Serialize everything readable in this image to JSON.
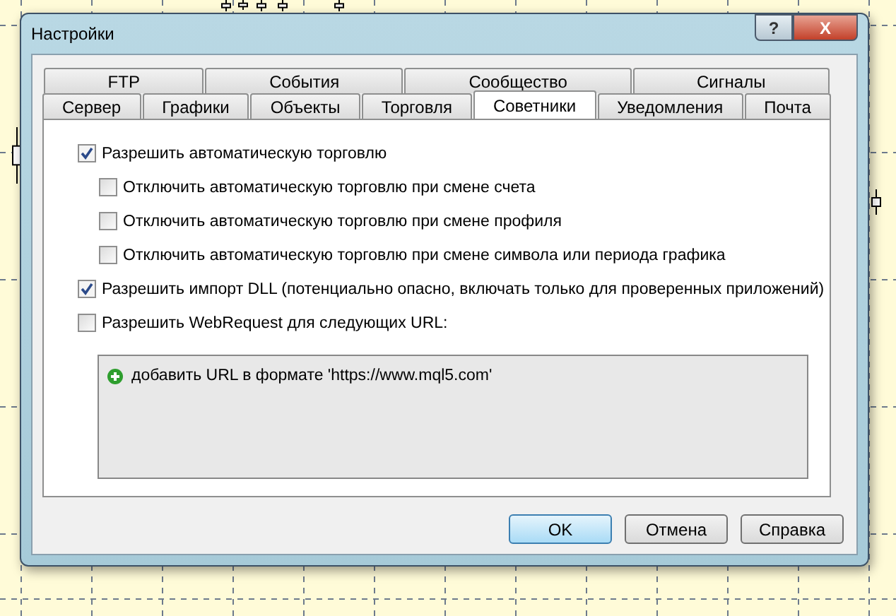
{
  "window": {
    "title": "Настройки",
    "buttons": [
      {
        "kind": "help",
        "label": "?"
      },
      {
        "kind": "close",
        "label": "X"
      }
    ]
  },
  "tab_rows": [
    {
      "tabs": [
        {
          "label": "FTP",
          "selected": false
        },
        {
          "label": "События",
          "selected": false
        },
        {
          "label": "Сообщество",
          "selected": false
        },
        {
          "label": "Сигналы",
          "selected": false
        }
      ]
    },
    {
      "tabs": [
        {
          "label": "Сервер",
          "selected": false
        },
        {
          "label": "Графики",
          "selected": false
        },
        {
          "label": "Объекты",
          "selected": false
        },
        {
          "label": "Торговля",
          "selected": false
        },
        {
          "label": "Советники",
          "selected": true
        },
        {
          "label": "Уведомления",
          "selected": false
        },
        {
          "label": "Почта",
          "selected": false
        }
      ]
    }
  ],
  "options": [
    {
      "label": "Разрешить автоматическую торговлю",
      "checked": true,
      "children": [
        {
          "label": "Отключить автоматическую торговлю при смене счета",
          "checked": false
        },
        {
          "label": "Отключить автоматическую торговлю при смене профиля",
          "checked": false
        },
        {
          "label": "Отключить автоматическую торговлю при смене символа или периода графика",
          "checked": false
        }
      ]
    },
    {
      "label": "Разрешить импорт DLL (потенциально опасно, включать только для проверенных приложений)",
      "checked": true
    },
    {
      "label": "Разрешить WebRequest для следующих URL:",
      "checked": false
    }
  ],
  "url_list": {
    "items": [
      {
        "label": "добавить URL в формате 'https://www.mql5.com'"
      }
    ]
  },
  "buttons": [
    {
      "label": "OK",
      "selected": true
    },
    {
      "label": "Отмена",
      "selected": false
    },
    {
      "label": "Справка",
      "selected": false
    }
  ]
}
